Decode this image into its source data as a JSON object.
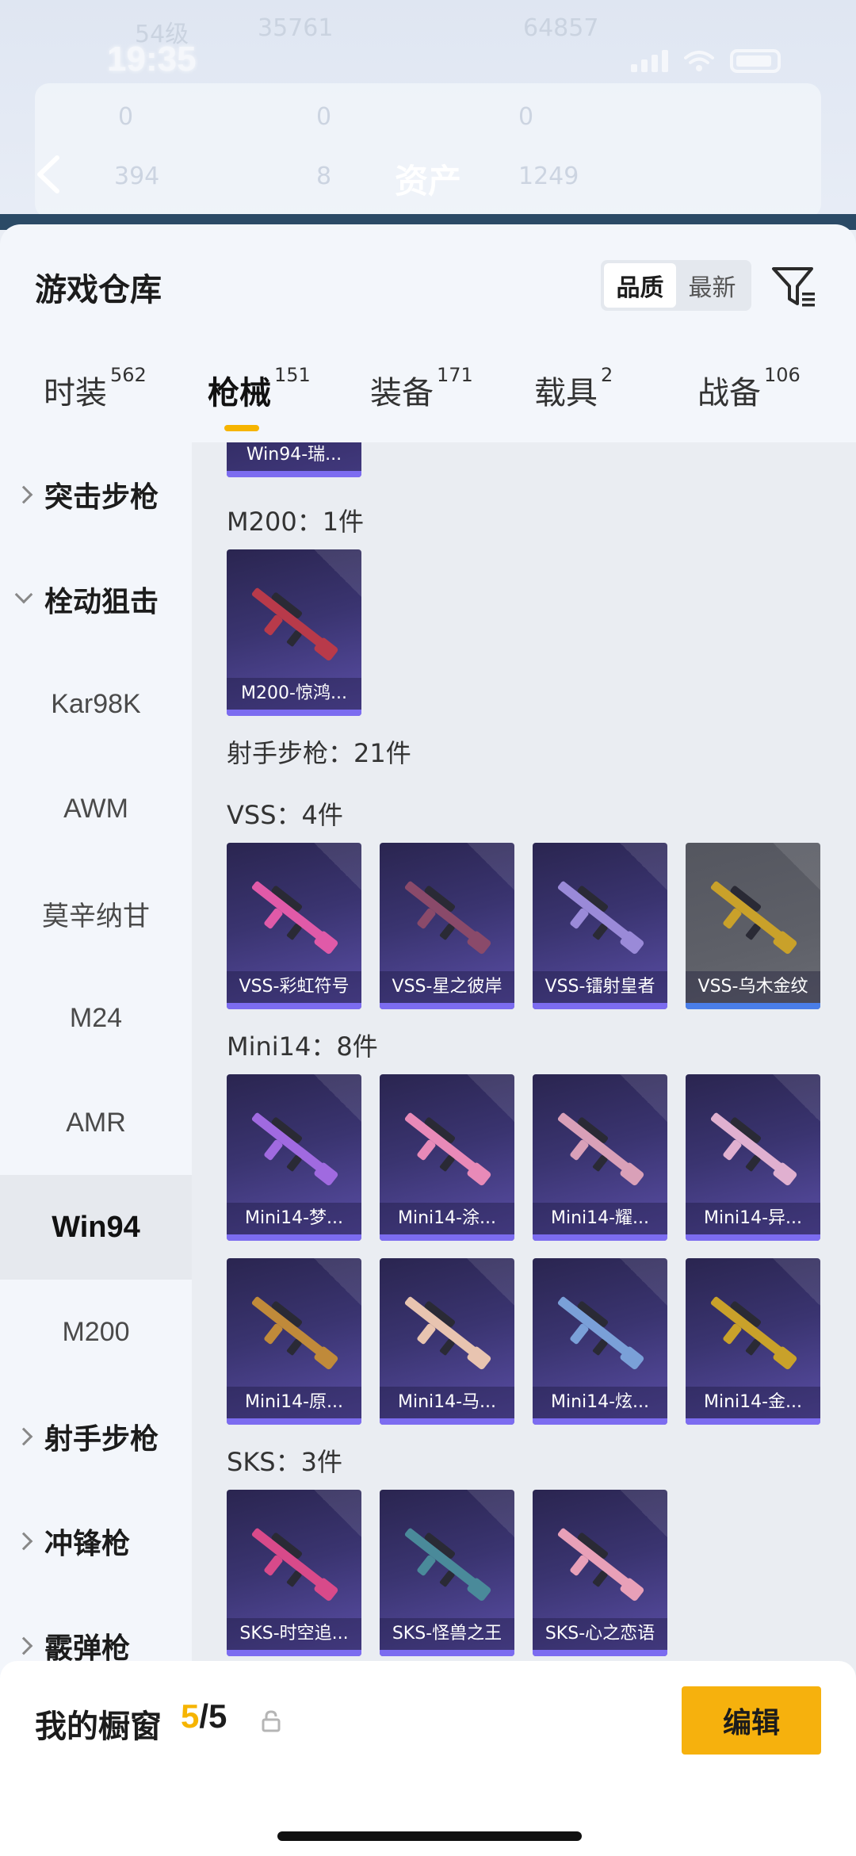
{
  "status": {
    "time": "19:35"
  },
  "background": {
    "title": "资产",
    "level_text": "54级",
    "score_a": "35761",
    "score_b": "64857",
    "counts": [
      "0",
      "0",
      "0",
      "394",
      "8",
      "1249"
    ]
  },
  "sheet": {
    "title": "游戏仓库",
    "sort_options": [
      "品质",
      "最新"
    ],
    "sort_selected": "品质"
  },
  "tabs": [
    {
      "label": "时装",
      "count": "562"
    },
    {
      "label": "枪械",
      "count": "151",
      "active": true
    },
    {
      "label": "装备",
      "count": "171"
    },
    {
      "label": "载具",
      "count": "2"
    },
    {
      "label": "战备",
      "count": "106"
    }
  ],
  "sidenav": [
    {
      "label": "突击步枪",
      "type": "group",
      "expanded": false
    },
    {
      "label": "栓动狙击",
      "type": "group",
      "expanded": true
    },
    {
      "label": "Kar98K",
      "type": "sub"
    },
    {
      "label": "AWM",
      "type": "sub"
    },
    {
      "label": "莫辛纳甘",
      "type": "sub"
    },
    {
      "label": "M24",
      "type": "sub"
    },
    {
      "label": "AMR",
      "type": "sub"
    },
    {
      "label": "Win94",
      "type": "sub",
      "selected": true
    },
    {
      "label": "M200",
      "type": "sub"
    },
    {
      "label": "射手步枪",
      "type": "group",
      "expanded": false
    },
    {
      "label": "冲锋枪",
      "type": "group",
      "expanded": false
    },
    {
      "label": "霰弹枪",
      "type": "group",
      "expanded": false
    }
  ],
  "content": {
    "partial_card": "Win94-瑞...",
    "sections": [
      {
        "label": "M200：1件",
        "items": [
          {
            "name": "M200-惊鸿...",
            "gun_color": "#b83a4a"
          }
        ]
      },
      {
        "label": "射手步枪：21件",
        "items": []
      },
      {
        "label": "VSS：4件",
        "items": [
          {
            "name": "VSS-彩虹符号",
            "gun_color": "#e05aa8"
          },
          {
            "name": "VSS-星之彼岸",
            "gun_color": "#8a4a6a"
          },
          {
            "name": "VSS-镭射皇者",
            "gun_color": "#9a8ad8"
          },
          {
            "name": "VSS-乌木金纹",
            "gun_color": "#c9a12a",
            "gray": true
          }
        ]
      },
      {
        "label": "Mini14：8件",
        "items": [
          {
            "name": "Mini14-梦...",
            "gun_color": "#a06ae0"
          },
          {
            "name": "Mini14-涂...",
            "gun_color": "#e88ab8"
          },
          {
            "name": "Mini14-耀...",
            "gun_color": "#d9a0b8"
          },
          {
            "name": "Mini14-异...",
            "gun_color": "#e0b0d0"
          },
          {
            "name": "Mini14-原...",
            "gun_color": "#c08a3a"
          },
          {
            "name": "Mini14-马...",
            "gun_color": "#e8c4b0"
          },
          {
            "name": "Mini14-炫...",
            "gun_color": "#7aa0d8"
          },
          {
            "name": "Mini14-金...",
            "gun_color": "#c9a12a"
          }
        ]
      },
      {
        "label": "SKS：3件",
        "items": [
          {
            "name": "SKS-时空追...",
            "gun_color": "#d84a8a"
          },
          {
            "name": "SKS-怪兽之王",
            "gun_color": "#4a8a9a"
          },
          {
            "name": "SKS-心之恋语",
            "gun_color": "#e8a0b8"
          }
        ]
      }
    ]
  },
  "bottombar": {
    "label": "我的橱窗",
    "current": "5",
    "total": "/5",
    "edit_label": "编辑"
  },
  "colors": {
    "accent": "#f6b400",
    "fab": "#f8b41b",
    "card_bg": "#3a3470",
    "card_stripe": "#7c6cf0"
  },
  "icons": [
    "filter-icon",
    "share-icon",
    "lock-icon",
    "back-icon",
    "chevron-right-icon",
    "chevron-down-icon"
  ]
}
